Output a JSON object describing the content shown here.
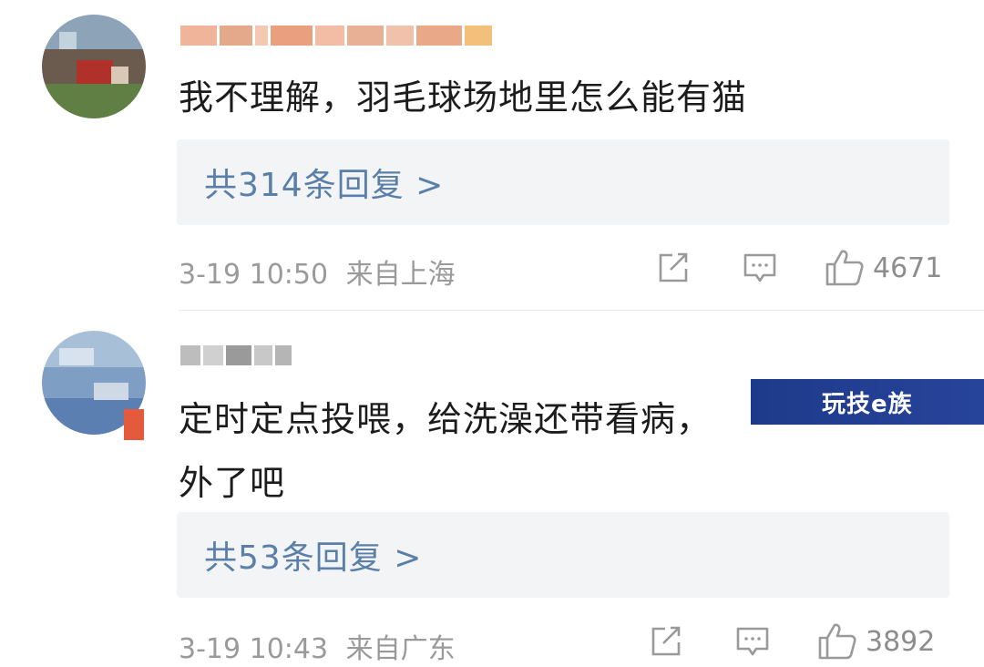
{
  "comments": [
    {
      "content": "我不理解，羽毛球场地里怎么能有猫",
      "replies": "共314条回复 >",
      "timestamp": "3-19 10:50",
      "location": "来自上海",
      "likes": "4671"
    },
    {
      "content_line1": "定时定点投喂，给洗澡还带看病，",
      "content_line2": "外了吧",
      "replies": "共53条回复 >",
      "timestamp": "3-19 10:43",
      "location": "来自广东",
      "likes": "3892"
    }
  ],
  "watermark": "玩技e族",
  "icons": [
    "share-icon",
    "comment-icon",
    "like-icon"
  ]
}
